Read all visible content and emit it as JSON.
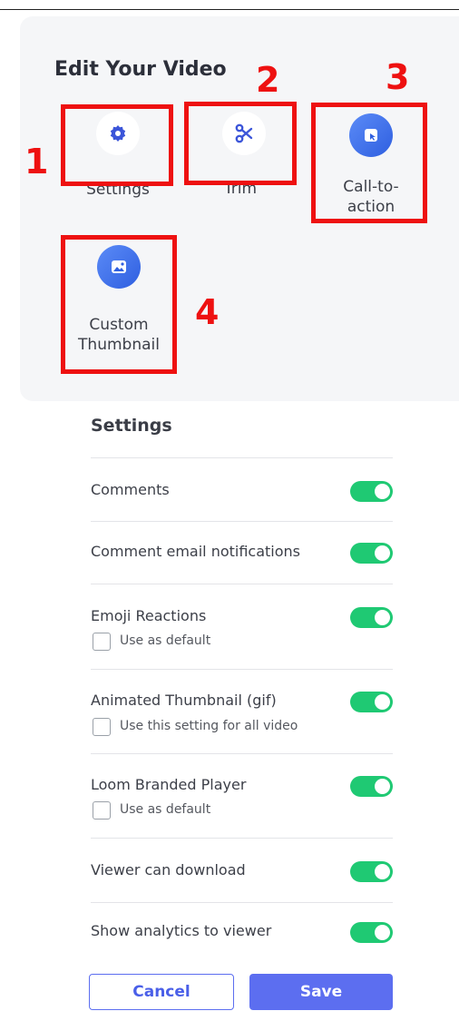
{
  "panel": {
    "title": "Edit Your Video",
    "tools": [
      {
        "label": "Settings",
        "number": "1",
        "icon": "gear-icon"
      },
      {
        "label": "Trim",
        "number": "2",
        "icon": "scissors-icon"
      },
      {
        "label_line1": "Call-to-",
        "label_line2": "action",
        "number": "3",
        "icon": "cursor-icon"
      },
      {
        "label_line1": "Custom",
        "label_line2": "Thumbnail",
        "number": "4",
        "icon": "image-icon"
      }
    ]
  },
  "settings": {
    "title": "Settings",
    "rows": [
      {
        "label": "Comments",
        "enabled": true
      },
      {
        "label": "Comment email notifications",
        "enabled": true
      },
      {
        "label": "Emoji Reactions",
        "enabled": true,
        "checkbox_label": "Use as default",
        "checked": false
      },
      {
        "label": "Animated Thumbnail (gif)",
        "enabled": true,
        "checkbox_label": "Use this setting for all video",
        "checked": false
      },
      {
        "label": "Loom Branded Player",
        "enabled": true,
        "checkbox_label": "Use as default",
        "checked": false
      },
      {
        "label": "Viewer can download",
        "enabled": true
      },
      {
        "label": "Show analytics to viewer",
        "enabled": true
      }
    ]
  },
  "buttons": {
    "cancel": "Cancel",
    "save": "Save"
  },
  "colors": {
    "annotation_red": "#ee1111",
    "toggle_on": "#1fc973",
    "primary": "#5c6ef0"
  }
}
